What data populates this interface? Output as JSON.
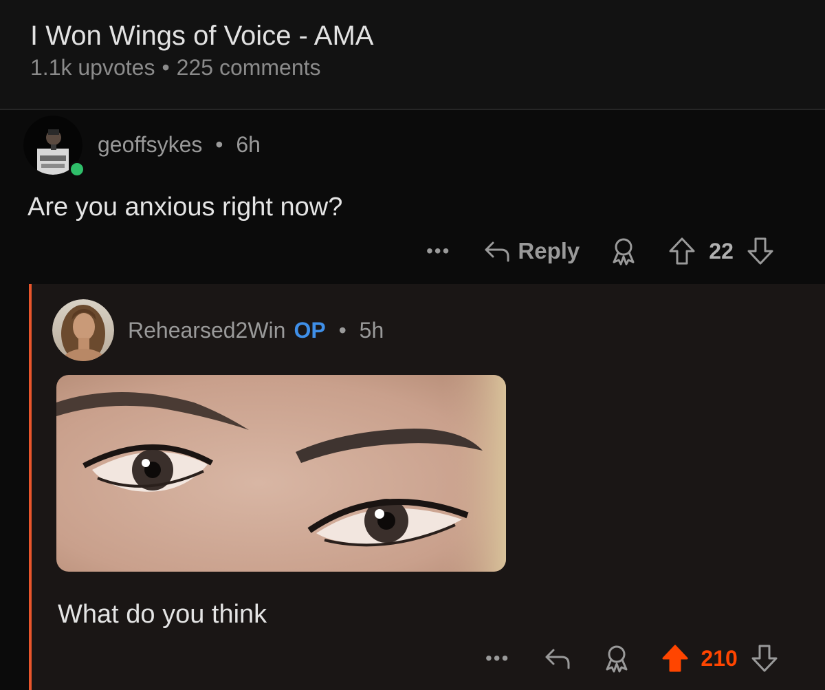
{
  "post": {
    "title": "I Won Wings of Voice - AMA",
    "upvotes": "1.1k upvotes",
    "separator": "•",
    "comments": "225 comments"
  },
  "comment1": {
    "username": "geoffsykes",
    "separator": "•",
    "time": "6h",
    "body": "Are you anxious right now?",
    "more": "•••",
    "reply_label": "Reply",
    "votes": "22"
  },
  "comment2": {
    "username": "Rehearsed2Win",
    "op_badge": "OP",
    "separator": "•",
    "time": "5h",
    "body": "What do you think",
    "more": "•••",
    "votes": "210",
    "vote_color": "#ff4500"
  },
  "colors": {
    "thread_line": "#e8552b",
    "op_badge": "#3f8fe8",
    "online": "#2fbf6a"
  },
  "icons": [
    "more-icon",
    "reply-icon",
    "award-icon",
    "upvote-icon",
    "downvote-icon"
  ]
}
